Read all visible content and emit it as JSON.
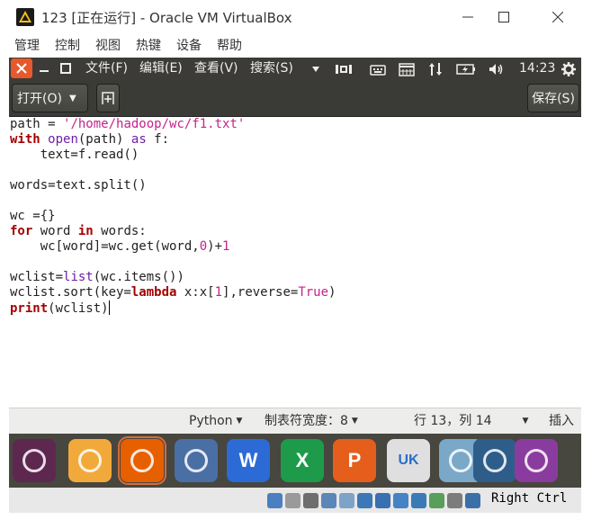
{
  "host": {
    "title": "123 [正在运行] - Oracle VM VirtualBox",
    "menu": [
      "管理",
      "控制",
      "视图",
      "热键",
      "设备",
      "帮助"
    ]
  },
  "guest_panel": {
    "menus": [
      "文件(F)",
      "编辑(E)",
      "查看(V)",
      "搜索(S)"
    ],
    "time": "14:23"
  },
  "gedit": {
    "open_label": "打开(O)",
    "save_label": "保存(S)"
  },
  "code_lines": [
    [
      {
        "t": "path = ",
        "c": "plain"
      },
      {
        "t": "'/home/hadoop/wc/f1.txt'",
        "c": "str"
      }
    ],
    [
      {
        "t": "with",
        "c": "kw"
      },
      {
        "t": " ",
        "c": "plain"
      },
      {
        "t": "open",
        "c": "fn"
      },
      {
        "t": "(path) ",
        "c": "plain"
      },
      {
        "t": "as",
        "c": "fn"
      },
      {
        "t": " f:",
        "c": "plain"
      }
    ],
    [
      {
        "t": "    text=f.read()",
        "c": "plain"
      }
    ],
    [],
    [
      {
        "t": "words=text.split()",
        "c": "plain"
      }
    ],
    [],
    [
      {
        "t": "wc ={}",
        "c": "plain"
      }
    ],
    [
      {
        "t": "for",
        "c": "kw"
      },
      {
        "t": " word ",
        "c": "plain"
      },
      {
        "t": "in",
        "c": "kw"
      },
      {
        "t": " words:",
        "c": "plain"
      }
    ],
    [
      {
        "t": "    wc[word]=wc.get(word,",
        "c": "plain"
      },
      {
        "t": "0",
        "c": "num"
      },
      {
        "t": ")+",
        "c": "plain"
      },
      {
        "t": "1",
        "c": "num"
      }
    ],
    [],
    [
      {
        "t": "wclist=",
        "c": "plain"
      },
      {
        "t": "list",
        "c": "fn"
      },
      {
        "t": "(wc.items())",
        "c": "plain"
      }
    ],
    [
      {
        "t": "wclist.sort(key=",
        "c": "plain"
      },
      {
        "t": "lambda",
        "c": "kw"
      },
      {
        "t": " x:x[",
        "c": "plain"
      },
      {
        "t": "1",
        "c": "num"
      },
      {
        "t": "],reverse=",
        "c": "plain"
      },
      {
        "t": "True",
        "c": "str"
      },
      {
        "t": ")",
        "c": "plain"
      }
    ],
    [
      {
        "t": "print",
        "c": "kw"
      },
      {
        "t": "(wclist)",
        "c": "plain"
      }
    ]
  ],
  "status": {
    "language": "Python",
    "tab_width": "制表符宽度：8",
    "position": "行 13，列 14",
    "insert_mode": "插入"
  },
  "dock_items": [
    {
      "name": "ubuntu-dash",
      "bg": "#5e2750",
      "icon": "ubuntu-logo-icon"
    },
    {
      "name": "files",
      "bg": "#f2a93b",
      "icon": "folder-icon"
    },
    {
      "name": "firefox",
      "bg": "#e66000",
      "icon": "firefox-icon"
    },
    {
      "name": "chromium",
      "bg": "#4a6fa5",
      "icon": "chromium-icon"
    },
    {
      "name": "wps-writer",
      "bg": "#2c6bd6",
      "icon": "writer-icon",
      "label": "W"
    },
    {
      "name": "wps-spreadsheets",
      "bg": "#1e9b4a",
      "icon": "spreadsheet-icon",
      "label": "X"
    },
    {
      "name": "wps-presentation",
      "bg": "#e55e1c",
      "icon": "presentation-icon",
      "label": "P"
    },
    {
      "name": "software-center",
      "bg": "#dfdfdf",
      "icon": "shopping-bag-icon",
      "label": "UK"
    },
    {
      "name": "update-manager",
      "bg": "#7aa8c8",
      "icon": "update-icon"
    },
    {
      "name": "terminal",
      "bg": "#2f5d8a",
      "icon": "arrow-icon"
    },
    {
      "name": "gedit",
      "bg": "#8a3c9e",
      "icon": "pencil-icon"
    }
  ],
  "vbox": {
    "host_key": "Right Ctrl"
  },
  "colors": {
    "ubuntu_panel": "#3c3b37",
    "close_orange": "#e7592b",
    "keyword": "#a40000",
    "string": "#c4228b",
    "builtin": "#6b1fa8"
  }
}
